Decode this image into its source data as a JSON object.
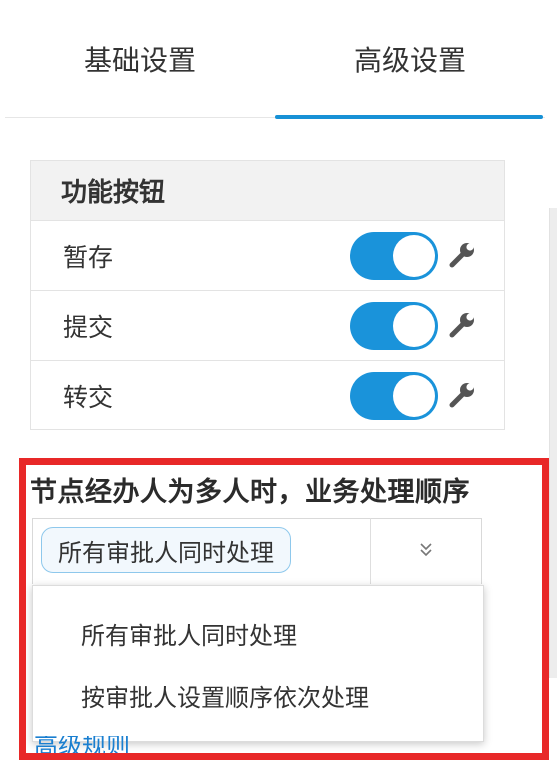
{
  "tabs": [
    {
      "label": "基础设置",
      "active": false
    },
    {
      "label": "高级设置",
      "active": true
    }
  ],
  "accent_color": "#1791d6",
  "function_buttons": {
    "header": "功能按钮",
    "rows": [
      {
        "label": "暂存",
        "enabled": true
      },
      {
        "label": "提交",
        "enabled": true
      },
      {
        "label": "转交",
        "enabled": true
      }
    ]
  },
  "order": {
    "label": "节点经办人为多人时，业务处理顺序",
    "selected": "所有审批人同时处理",
    "options": [
      "所有审批人同时处理",
      "按审批人设置顺序依次处理"
    ],
    "highlight_color": "#e82828"
  },
  "partial_link": "高级规则"
}
